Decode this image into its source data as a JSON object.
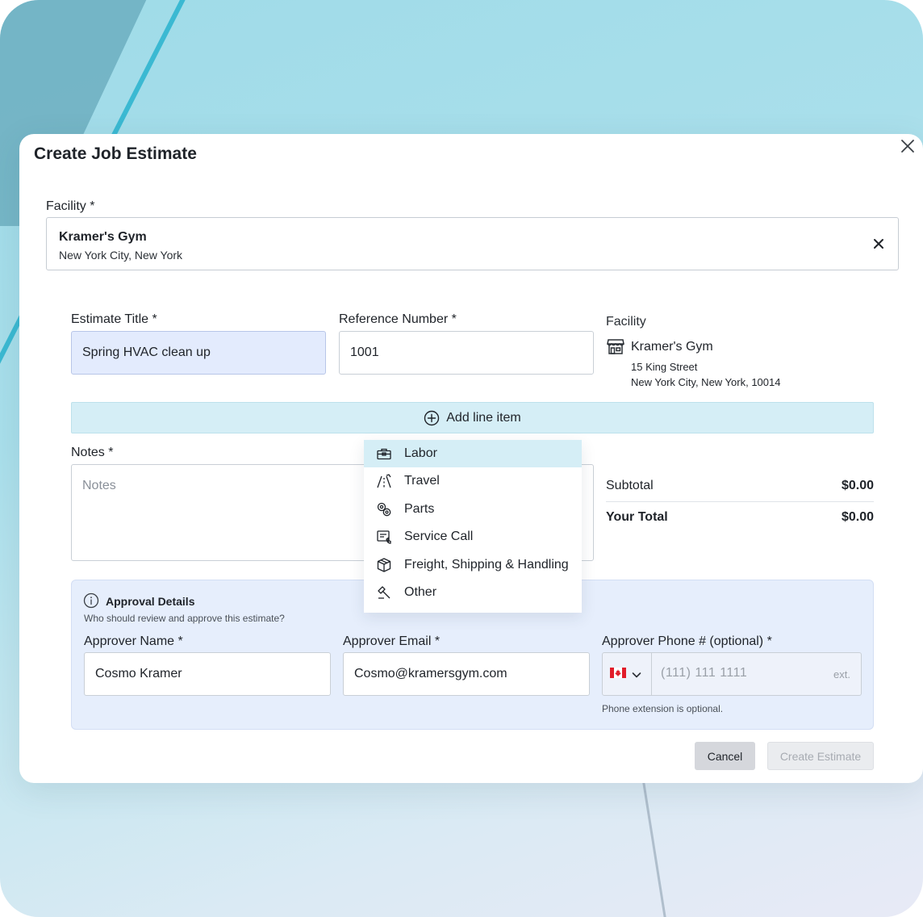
{
  "modal": {
    "title": "Create Job Estimate"
  },
  "facility_field": {
    "label": "Facility",
    "required": "*",
    "selected_name": "Kramer's Gym",
    "selected_city": "New York City, New York"
  },
  "estimate_title": {
    "label": "Estimate Title",
    "required": "*",
    "value": "Spring HVAC clean up"
  },
  "reference_number": {
    "label": "Reference Number",
    "required": "*",
    "value": "1001"
  },
  "facility_info": {
    "title": "Facility",
    "name": "Kramer's Gym",
    "street": "15 King Street",
    "city_line": "New York City, New York, 10014",
    "icon": "store-icon"
  },
  "add_line_item": {
    "label": "Add line item",
    "icon": "plus-circle-icon"
  },
  "line_item_menu": {
    "items": [
      {
        "label": "Labor",
        "icon": "toolbox-icon",
        "active": true
      },
      {
        "label": "Travel",
        "icon": "road-icon",
        "active": false
      },
      {
        "label": "Parts",
        "icon": "gears-icon",
        "active": false
      },
      {
        "label": "Service Call",
        "icon": "service-call-icon",
        "active": false
      },
      {
        "label": "Freight, Shipping & Handling",
        "icon": "package-icon",
        "active": false
      },
      {
        "label": "Other",
        "icon": "hammer-icon",
        "active": false
      }
    ]
  },
  "notes": {
    "label": "Notes",
    "required": "*",
    "placeholder": "Notes"
  },
  "totals": {
    "subtotal_label": "Subtotal",
    "subtotal_value": "$0.00",
    "total_label": "Your Total",
    "total_value": "$0.00"
  },
  "approval": {
    "title": "Approval Details",
    "subtitle": "Who should review and approve this estimate?",
    "name_label": "Approver Name",
    "name_value": "Cosmo Kramer",
    "email_label": "Approver Email",
    "email_value": "Cosmo@kramersgym.com",
    "phone_label": "Approver Phone # (optional)",
    "required": "*",
    "phone_placeholder": "(111) 111 1111",
    "ext_placeholder": "ext.",
    "phone_help": "Phone extension is optional.",
    "country_flag": "canada-flag-icon"
  },
  "actions": {
    "cancel": "Cancel",
    "create": "Create Estimate"
  },
  "colors": {
    "accent_light": "#d5eef6",
    "filled_input": "#e3ebfd",
    "approval_bg": "#e6eefc"
  }
}
